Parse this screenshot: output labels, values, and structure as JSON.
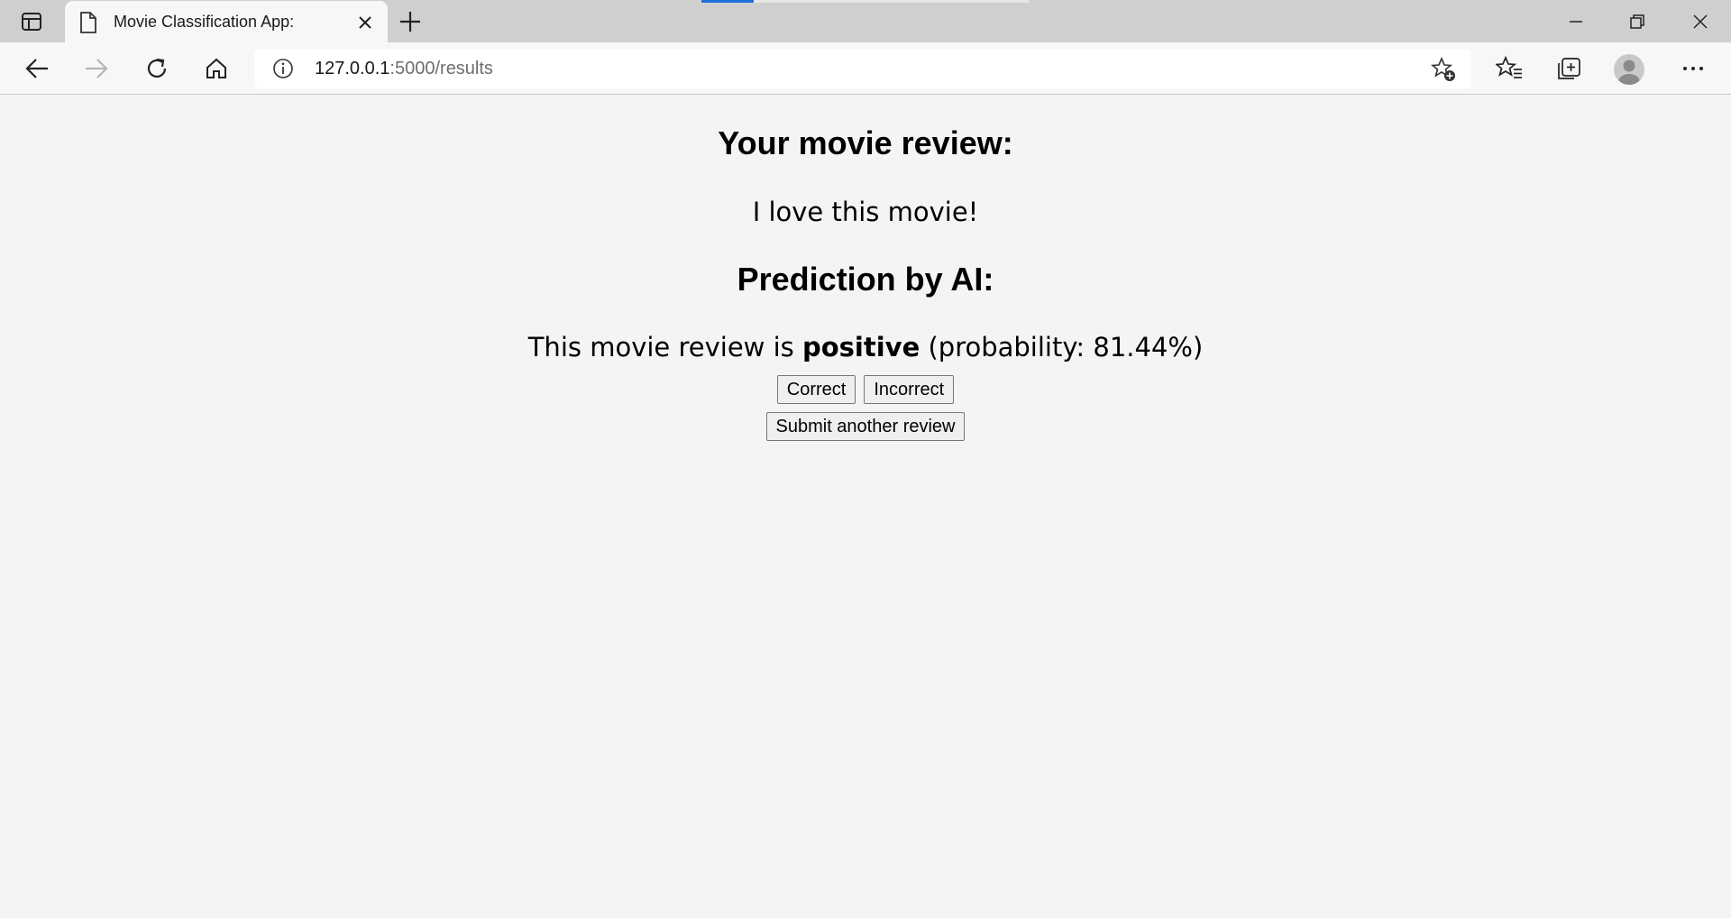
{
  "browser": {
    "tab": {
      "title": "Movie Classification App:"
    },
    "address": {
      "host": "127.0.0.1",
      "rest": ":5000/results"
    },
    "page_load_progress": 0.16
  },
  "page": {
    "review_heading": "Your movie review:",
    "review_text": "I love this movie!",
    "prediction_heading": "Prediction by AI:",
    "prediction_prefix": "This movie review is",
    "prediction_label": "positive",
    "prediction_suffix": "(probability: 81.44%)",
    "buttons": {
      "correct": "Correct",
      "incorrect": "Incorrect",
      "submit_another": "Submit another review"
    }
  },
  "icons": {
    "tab_actions": "tab-actions-icon",
    "favicon": "page-icon",
    "close": "close-icon",
    "new_tab": "plus-icon",
    "back": "arrow-left-icon",
    "forward": "arrow-right-icon",
    "refresh": "refresh-icon",
    "home": "home-icon",
    "info": "info-icon",
    "add_favorite": "star-plus-icon",
    "favorites": "favorites-icon",
    "collections": "collections-icon",
    "profile": "avatar-icon",
    "more": "more-icon"
  },
  "colors": {
    "accent": "#1e6fd9",
    "page_background": "#f3f4f6"
  }
}
